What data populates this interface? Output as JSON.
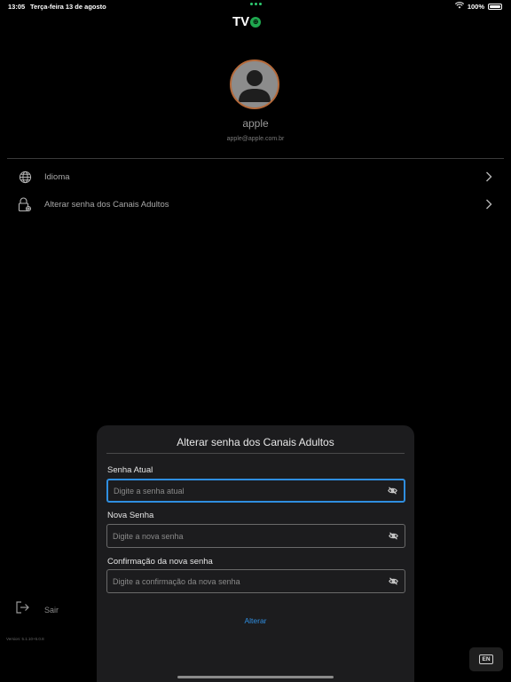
{
  "status_bar": {
    "time": "13:05",
    "date": "Terça-feira 13 de agosto",
    "battery": "100%",
    "icons": [
      "wifi-icon",
      "battery-icon"
    ]
  },
  "logo": {
    "text": "TV",
    "badge": "⊕"
  },
  "profile": {
    "name": "apple",
    "email": "apple@apple.com.br"
  },
  "menu": {
    "items": [
      {
        "label": "Idioma",
        "icon": "globe-icon"
      },
      {
        "label": "Alterar senha dos Canais Adultos",
        "icon": "lock-settings-icon"
      }
    ]
  },
  "logout": {
    "label": "Sair",
    "icon": "logout-icon"
  },
  "version": "Version: 5.1.10+5.0.8",
  "modal": {
    "title": "Alterar senha dos Canais Adultos",
    "fields": [
      {
        "label": "Senha Atual",
        "placeholder": "Digite a senha atual",
        "value": ""
      },
      {
        "label": "Nova Senha",
        "placeholder": "Digite a nova senha",
        "value": ""
      },
      {
        "label": "Confirmação da nova senha",
        "placeholder": "Digite a confirmação da nova senha",
        "value": ""
      }
    ],
    "submit_label": "Alterar"
  },
  "language_button": {
    "label": "EN"
  },
  "colors": {
    "background": "#000000",
    "modal": "#1c1c1e",
    "accent": "#2f8ee0",
    "avatar_border": "#b56a3b",
    "logo_badge": "#1fa84f"
  }
}
